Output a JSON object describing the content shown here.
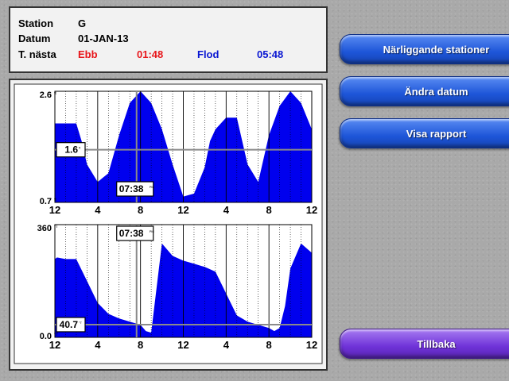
{
  "info": {
    "station_label": "Station",
    "station_value": "G",
    "date_label": "Datum",
    "date_value": "01-JAN-13",
    "next_label": "T. nästa",
    "ebb_label": "Ebb",
    "ebb_time": "01:48",
    "flood_label": "Flod",
    "flood_time": "05:48"
  },
  "buttons": {
    "nearby": "Närliggande stationer",
    "change_date": "Ändra datum",
    "show_report": "Visa rapport",
    "back": "Tillbaka"
  },
  "colors": {
    "tide_fill": "#0000ee",
    "ebb_text": "#e8161b",
    "flood_text": "#0a17d2",
    "blue_button": "#2b63e6",
    "purple_button": "#7b3fe4"
  },
  "chart_data": [
    {
      "type": "area",
      "ymin_label": "0.7",
      "ymax_label": "2.6",
      "unit_label": "ft",
      "ylim": [
        0.7,
        2.6
      ],
      "x_ticks": [
        "12",
        "4",
        "8",
        "12",
        "4",
        "8",
        "12"
      ],
      "x": [
        0,
        1,
        2,
        2.5,
        3,
        4,
        5,
        6,
        7,
        8,
        9,
        10,
        11,
        12,
        13,
        14,
        14.5,
        15,
        16,
        17,
        18,
        19,
        20,
        21,
        22,
        23,
        24
      ],
      "values": [
        2.05,
        2.05,
        2.05,
        1.75,
        1.35,
        1.05,
        1.2,
        1.85,
        2.4,
        2.6,
        2.4,
        1.95,
        1.35,
        0.8,
        0.85,
        1.3,
        1.75,
        1.95,
        2.15,
        2.15,
        1.35,
        1.05,
        1.85,
        2.35,
        2.6,
        2.4,
        1.95
      ],
      "cursor_time": "07:38",
      "cursor_value": "1.6",
      "cursor_unit": "ft"
    },
    {
      "type": "area",
      "ymin_label": "0.0",
      "ymax_label": "360",
      "unit_label": "°T",
      "ylim": [
        0,
        360
      ],
      "x_ticks": [
        "12",
        "4",
        "8",
        "12",
        "4",
        "8",
        "12"
      ],
      "x": [
        0,
        0.2,
        1,
        2,
        3,
        4,
        5,
        6,
        7,
        7.5,
        8,
        8.5,
        9,
        10,
        11,
        12,
        13,
        14,
        15,
        16,
        17,
        18,
        19,
        20,
        20.5,
        21,
        21.5,
        22,
        23,
        24
      ],
      "values": [
        250,
        255,
        250,
        250,
        180,
        110,
        75,
        60,
        50,
        45,
        40,
        20,
        15,
        300,
        260,
        245,
        235,
        225,
        210,
        140,
        70,
        50,
        40,
        30,
        20,
        30,
        100,
        220,
        300,
        270
      ],
      "cursor_time": "07:38",
      "cursor_value": "40.7",
      "cursor_unit": "°T"
    }
  ]
}
